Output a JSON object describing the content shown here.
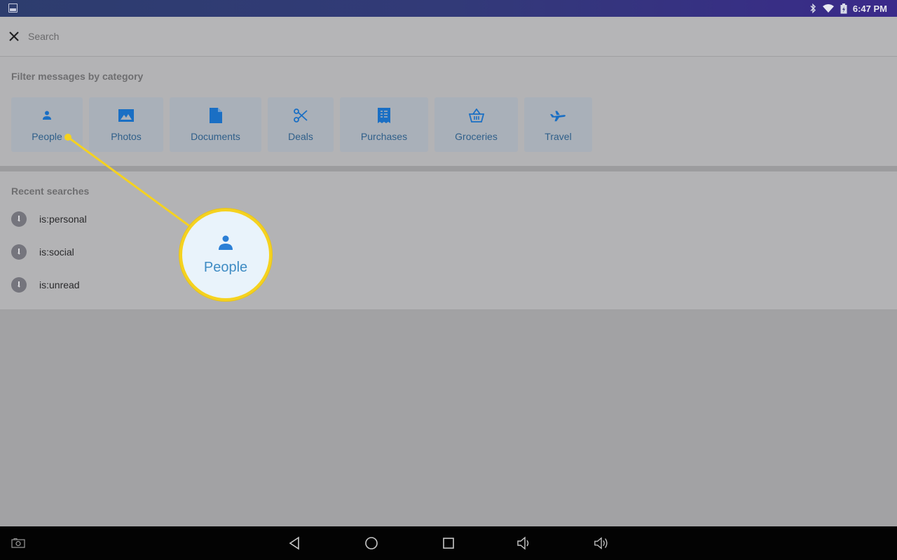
{
  "status_bar": {
    "time": "6:47 PM",
    "icons": [
      "image-notification-icon",
      "bluetooth-icon",
      "wifi-icon",
      "battery-charging-icon"
    ]
  },
  "search": {
    "placeholder": "Search",
    "value": "",
    "close_icon": "close-icon"
  },
  "filter": {
    "title": "Filter messages by category",
    "categories": [
      {
        "label": "People",
        "icon": "person-icon"
      },
      {
        "label": "Photos",
        "icon": "photo-icon"
      },
      {
        "label": "Documents",
        "icon": "document-icon"
      },
      {
        "label": "Deals",
        "icon": "scissors-icon"
      },
      {
        "label": "Purchases",
        "icon": "receipt-icon"
      },
      {
        "label": "Groceries",
        "icon": "basket-icon"
      },
      {
        "label": "Travel",
        "icon": "airplane-icon"
      }
    ]
  },
  "recent": {
    "title": "Recent searches",
    "items": [
      {
        "label": "is:personal",
        "icon": "clock-icon"
      },
      {
        "label": "is:social",
        "icon": "clock-icon"
      },
      {
        "label": "is:unread",
        "icon": "clock-icon"
      }
    ]
  },
  "callout": {
    "label": "People",
    "icon": "person-icon",
    "color": "#f5d21f"
  },
  "nav_bar": {
    "buttons": [
      "screenshot-icon",
      "back-icon",
      "home-icon",
      "recents-icon",
      "volume-down-icon",
      "volume-up-icon"
    ]
  },
  "colors": {
    "accent_icon": "#1a6fc4",
    "chip_label": "#2f5f8a",
    "callout_yellow": "#f5d21f"
  }
}
